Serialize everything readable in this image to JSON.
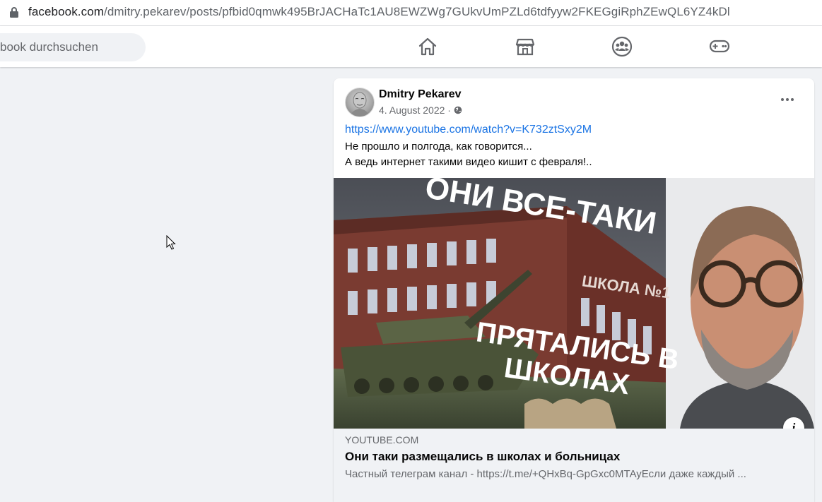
{
  "browser": {
    "url_host": "facebook.com",
    "url_path": "/dmitry.pekarev/posts/pfbid0qmwk495BrJACHaTc1AU8EWZWg7GUkvUmPZLd6tdfyyw2FKEGgiRphZEwQL6YZ4kDl"
  },
  "nav": {
    "search_placeholder": "book durchsuchen",
    "icons": [
      "home-icon",
      "marketplace-icon",
      "groups-icon",
      "gaming-icon"
    ]
  },
  "post": {
    "author": "Dmitry Pekarev",
    "date": "4. August 2022 ·",
    "link": "https://www.youtube.com/watch?v=K732ztSxy2M",
    "text_lines": [
      "Не прошло и полгода, как говорится...",
      "А ведь интернет такими видео кишит с февраля!.."
    ],
    "thumbnail": {
      "headline_top": "ОНИ ВСЕ-ТАКИ",
      "headline_bottom_1": "ПРЯТАЛИСЬ В",
      "headline_bottom_2": "ШКОЛАХ",
      "building_sign": "ШКОЛА №1"
    },
    "preview": {
      "domain": "YOUTUBE.COM",
      "title": "Они таки размещались в школах и больницах",
      "description": "Частный телеграм канал - https://t.me/+QHxBq-GpGxc0MTAyЕсли даже каждый ..."
    },
    "info_glyph": "i"
  },
  "colors": {
    "link": "#1b74e4",
    "background": "#f0f2f5",
    "secondary_text": "#65676b"
  }
}
